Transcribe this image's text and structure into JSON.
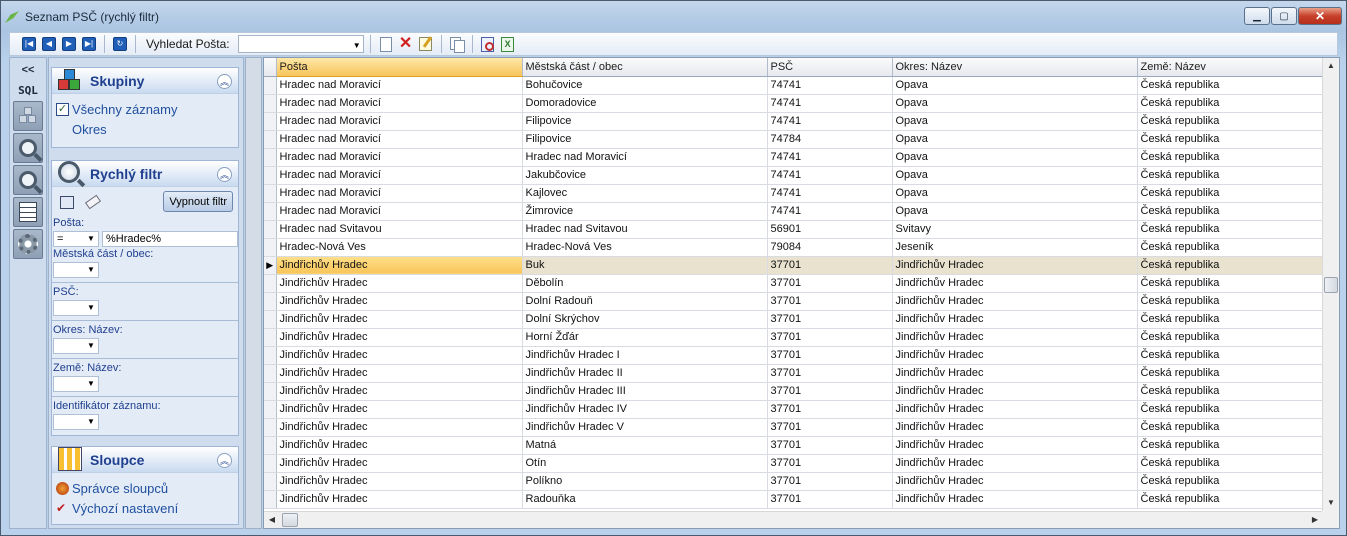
{
  "window": {
    "title": "Seznam PSČ (rychlý filtr)",
    "minimize": "▁",
    "maximize": "▢",
    "close": "✕"
  },
  "toolbar": {
    "search_label": "Vyhledat Pošta:",
    "search_value": "",
    "buttons": [
      "first",
      "previous",
      "next",
      "last",
      "refresh",
      "new",
      "delete",
      "edit",
      "copy",
      "export-pdf",
      "export-excel"
    ]
  },
  "leftbar": {
    "collapse": "<<",
    "sql": "SQL"
  },
  "groups": {
    "title": "Skupiny",
    "items": [
      "Všechny záznamy",
      "Okres"
    ]
  },
  "filter": {
    "title": "Rychlý filtr",
    "off_button": "Vypnout filtr",
    "fields": [
      {
        "label": "Pošta:",
        "op": "=",
        "value": "%Hradec%"
      },
      {
        "label": "Městská část / obec:",
        "op": "",
        "value": ""
      },
      {
        "label": "PSČ:",
        "op": "",
        "value": ""
      },
      {
        "label": "Okres: Název:",
        "op": "",
        "value": ""
      },
      {
        "label": "Země: Název:",
        "op": "",
        "value": ""
      },
      {
        "label": "Identifikátor záznamu:",
        "op": "",
        "value": ""
      }
    ]
  },
  "columns_group": {
    "title": "Sloupce",
    "items": [
      "Správce sloupců",
      "Výchozí nastavení"
    ]
  },
  "table": {
    "headers": [
      "Pošta",
      "Městská část / obec",
      "PSČ",
      "Okres: Název",
      "Země: Název"
    ],
    "current_row_index": 10,
    "rows": [
      [
        "Hradec nad Moravicí",
        "Bohučovice",
        "74741",
        "Opava",
        "Česká republika"
      ],
      [
        "Hradec nad Moravicí",
        "Domoradovice",
        "74741",
        "Opava",
        "Česká republika"
      ],
      [
        "Hradec nad Moravicí",
        "Filipovice",
        "74741",
        "Opava",
        "Česká republika"
      ],
      [
        "Hradec nad Moravicí",
        "Filipovice",
        "74784",
        "Opava",
        "Česká republika"
      ],
      [
        "Hradec nad Moravicí",
        "Hradec nad Moravicí",
        "74741",
        "Opava",
        "Česká republika"
      ],
      [
        "Hradec nad Moravicí",
        "Jakubčovice",
        "74741",
        "Opava",
        "Česká republika"
      ],
      [
        "Hradec nad Moravicí",
        "Kajlovec",
        "74741",
        "Opava",
        "Česká republika"
      ],
      [
        "Hradec nad Moravicí",
        "Žimrovice",
        "74741",
        "Opava",
        "Česká republika"
      ],
      [
        "Hradec nad Svitavou",
        "Hradec nad Svitavou",
        "56901",
        "Svitavy",
        "Česká republika"
      ],
      [
        "Hradec-Nová Ves",
        "Hradec-Nová Ves",
        "79084",
        "Jeseník",
        "Česká republika"
      ],
      [
        "Jindřichův Hradec",
        "Buk",
        "37701",
        "Jindřichův Hradec",
        "Česká republika"
      ],
      [
        "Jindřichův Hradec",
        "Děbolín",
        "37701",
        "Jindřichův Hradec",
        "Česká republika"
      ],
      [
        "Jindřichův Hradec",
        "Dolní Radouň",
        "37701",
        "Jindřichův Hradec",
        "Česká republika"
      ],
      [
        "Jindřichův Hradec",
        "Dolní Skrýchov",
        "37701",
        "Jindřichův Hradec",
        "Česká republika"
      ],
      [
        "Jindřichův Hradec",
        "Horní Žďár",
        "37701",
        "Jindřichův Hradec",
        "Česká republika"
      ],
      [
        "Jindřichův Hradec",
        "Jindřichův Hradec I",
        "37701",
        "Jindřichův Hradec",
        "Česká republika"
      ],
      [
        "Jindřichův Hradec",
        "Jindřichův Hradec II",
        "37701",
        "Jindřichův Hradec",
        "Česká republika"
      ],
      [
        "Jindřichův Hradec",
        "Jindřichův Hradec III",
        "37701",
        "Jindřichův Hradec",
        "Česká republika"
      ],
      [
        "Jindřichův Hradec",
        "Jindřichův Hradec IV",
        "37701",
        "Jindřichův Hradec",
        "Česká republika"
      ],
      [
        "Jindřichův Hradec",
        "Jindřichův Hradec V",
        "37701",
        "Jindřichův Hradec",
        "Česká republika"
      ],
      [
        "Jindřichův Hradec",
        "Matná",
        "37701",
        "Jindřichův Hradec",
        "Česká republika"
      ],
      [
        "Jindřichův Hradec",
        "Otín",
        "37701",
        "Jindřichův Hradec",
        "Česká republika"
      ],
      [
        "Jindřichův Hradec",
        "Políkno",
        "37701",
        "Jindřichův Hradec",
        "Česká republika"
      ],
      [
        "Jindřichův Hradec",
        "Radouňka",
        "37701",
        "Jindřichův Hradec",
        "Česká republika"
      ]
    ]
  },
  "colors": {
    "accent": "#1f3f8f",
    "sorted_header": "#f7c45a",
    "current_row": "#e8e2cf"
  }
}
